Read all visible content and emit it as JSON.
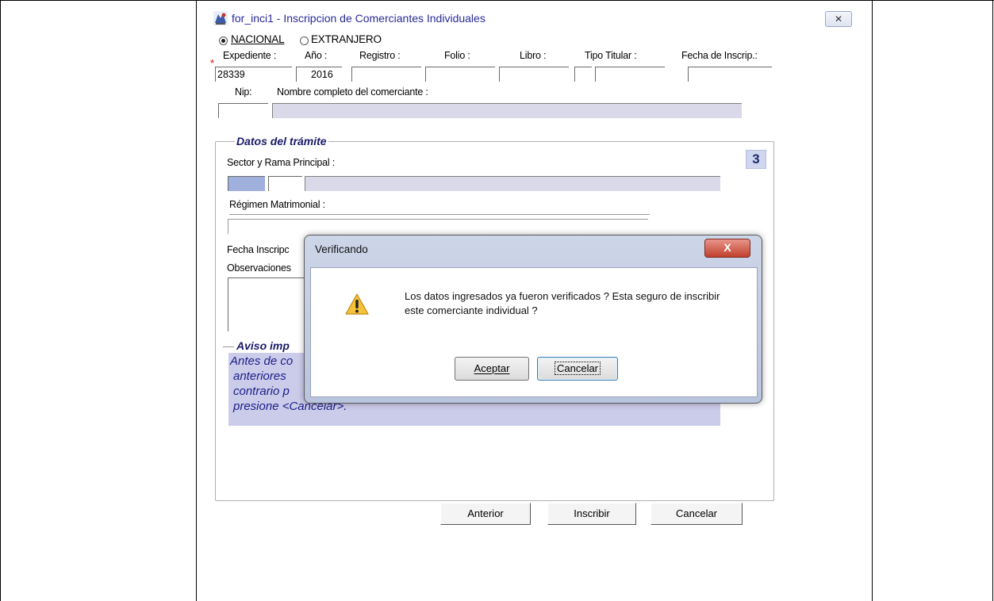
{
  "window": {
    "title": "for_inci1 - Inscripcion de Comerciantes Individuales",
    "close_glyph": "✕"
  },
  "origin": {
    "nacional_label": "NACIONAL",
    "extranjero_label": "EXTRANJERO",
    "selected": "NACIONAL"
  },
  "header_fields": {
    "required_marker": "*",
    "expediente_label": "Expediente :",
    "expediente_value": "28339",
    "anio_label": "Año :",
    "anio_value": "2016",
    "registro_label": "Registro :",
    "registro_value": "",
    "folio_label": "Folio :",
    "folio_value": "",
    "libro_label": "Libro :",
    "libro_value": "",
    "tipo_titular_label": "Tipo Titular :",
    "tipo_titular_value": "",
    "fecha_inscrip_label": "Fecha de Inscrip.:",
    "fecha_inscrip_value": "",
    "nip_label": "Nip:",
    "nip_value": "",
    "nombre_label": "Nombre completo del comerciante :",
    "nombre_value": ""
  },
  "tramite": {
    "group_title": "Datos del trámite",
    "page_badge": "3",
    "sector_label": "Sector y Rama Principal :",
    "regimen_label": "Régimen Matrimonial :",
    "fecha_label": "Fecha Inscripc",
    "observaciones_label": "Observaciones"
  },
  "aviso": {
    "group_title": "Aviso imp",
    "text_lines": [
      "Antes de co",
      "anteriores",
      "contrario p",
      "presione <Cancelar>."
    ]
  },
  "buttons": {
    "anterior": "Anterior",
    "inscribir": "Inscribir",
    "cancelar": "Cancelar"
  },
  "dialog": {
    "title": "Verificando",
    "close_glyph": "X",
    "message": "Los datos ingresados ya fueron verificados ? Esta seguro de inscribir este comerciante individual ?",
    "accept_label": "Aceptar",
    "cancel_label": "Cancelar",
    "icon": "warning-icon"
  },
  "colors": {
    "field_lavender": "#c8c9ea",
    "title_blue": "#2a2a9a",
    "notice_blue": "#1d1d8a",
    "close_red": "#c0402e"
  }
}
